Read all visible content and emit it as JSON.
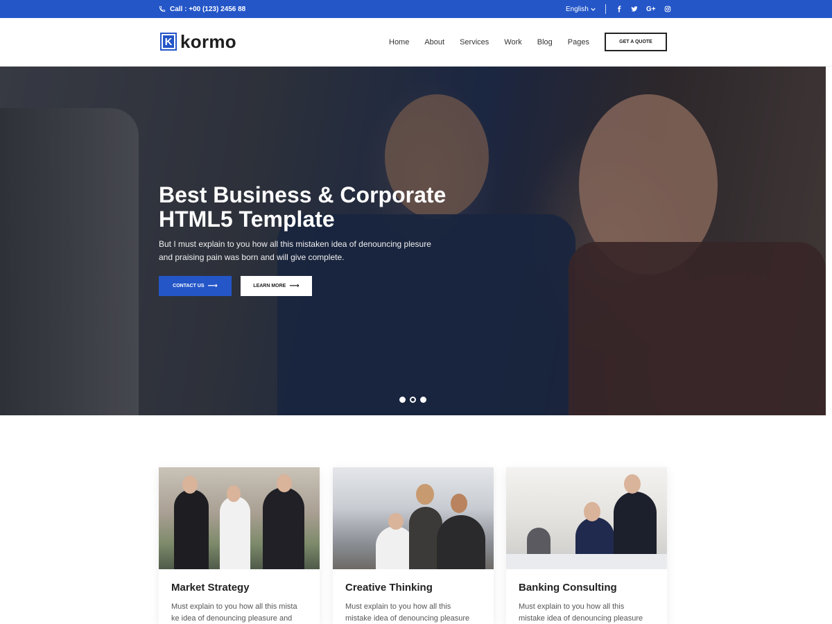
{
  "topbar": {
    "phone": "Call : +00 (123) 2456 88",
    "language": "English",
    "socials": [
      "facebook-icon",
      "twitter-icon",
      "google-plus-icon",
      "instagram-icon"
    ]
  },
  "header": {
    "logo_letter": "K",
    "logo_text": "kormo",
    "nav": [
      "Home",
      "About",
      "Services",
      "Work",
      "Blog",
      "Pages"
    ],
    "quote_button": "GET A QUOTE"
  },
  "hero": {
    "title_line1": "Best Business & Corporate",
    "title_line2": "HTML5 Template",
    "text_line1": "But I must explain to you how all this mistaken idea of denouncing plesure",
    "text_line2": "and praising pain was born and will give complete.",
    "contact_button": "CONTACT US",
    "learn_button": "LEARN MORE",
    "slide_count": 3,
    "active_slide": 2
  },
  "cards": [
    {
      "title": "Market Strategy",
      "text_line1": "Must explain to you how all this mista",
      "text_line2": "ke idea of denouncing pleasure and"
    },
    {
      "title": "Creative Thinking",
      "text_line1": "Must explain to you how all this",
      "text_line2": "mistake idea of denouncing pleasure"
    },
    {
      "title": "Banking Consulting",
      "text_line1": "Must explain to you how all this",
      "text_line2": "mistake idea of denouncing pleasure"
    }
  ],
  "colors": {
    "brand": "#2456c8",
    "dark": "#222222",
    "white": "#ffffff"
  }
}
